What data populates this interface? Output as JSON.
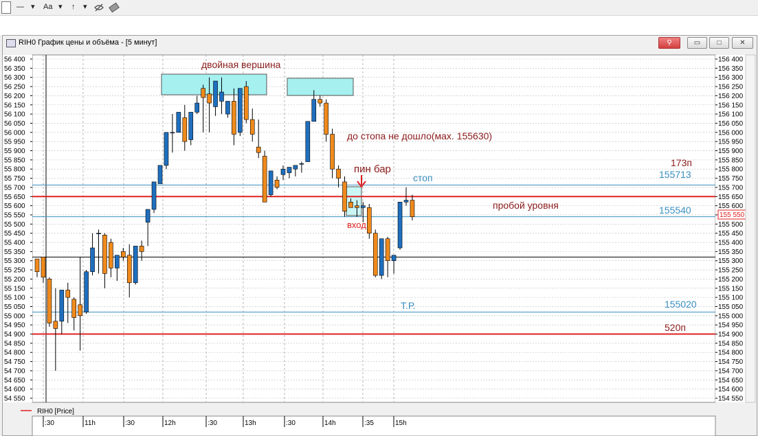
{
  "toolbar": {
    "line_tool": "—",
    "text_tool": "Aa",
    "arrow_tool": "↑",
    "dropdown": "▾"
  },
  "window": {
    "title": "RIH0 График цены и объёма - [5 минут]",
    "legend_label": "RIH0 [Price]"
  },
  "colors": {
    "bull": "#1f6fbf",
    "bear": "#f08a1c",
    "level_red": "#e02020",
    "level_blue": "#3a8fc0",
    "zone_fill": "#a6f0f0",
    "annotation_dark_red": "#8b1a1a",
    "annotation_blue": "#3a8fc0"
  },
  "annotations": {
    "double_top": "двойная вершина",
    "no_stop": "до стопа не дошло(мах. 155630)",
    "pin_bar": "пин бар",
    "entry": "вход",
    "stop": "стоп",
    "breakout": "пробой уровня",
    "tp": "Т.Р.",
    "pts_173": "173п",
    "pts_520": "520п",
    "lvl_155713": "155713",
    "lvl_155540": "155540",
    "lvl_155020": "155020",
    "price_marker": "155 550"
  },
  "chart_data": {
    "type": "candlestick",
    "y_ticks": [
      "56 400",
      "56 350",
      "56 300",
      "56 250",
      "56 200",
      "56 150",
      "56 100",
      "56 050",
      "56 000",
      "55 950",
      "55 900",
      "55 850",
      "55 800",
      "55 750",
      "55 700",
      "55 650",
      "55 600",
      "55 550",
      "55 500",
      "55 450",
      "55 400",
      "55 350",
      "55 300",
      "55 250",
      "55 200",
      "55 150",
      "55 100",
      "55 050",
      "55 000",
      "54 950",
      "54 900",
      "54 850",
      "54 800",
      "54 750",
      "54 700",
      "54 650",
      "54 600",
      "54 550"
    ],
    "y_ticks_right": [
      "156 400",
      "156 350",
      "156 300",
      "156 250",
      "156 200",
      "156 150",
      "156 100",
      "156 050",
      "156 000",
      "155 950",
      "155 900",
      "155 850",
      "155 800",
      "155 750",
      "155 700",
      "155 650",
      "155 600",
      "155 550",
      "155 500",
      "155 450",
      "155 400",
      "155 350",
      "155 300",
      "155 250",
      "155 200",
      "155 150",
      "155 100",
      "155 050",
      "155 000",
      "154 950",
      "154 900",
      "154 850",
      "154 800",
      "154 750",
      "154 700",
      "154 650",
      "154 600",
      "154 550"
    ],
    "ylim": [
      154550,
      156400
    ],
    "x_labels": [
      ":30",
      "11h",
      ":30",
      "12h",
      ":30",
      "13h",
      ":30",
      "14h",
      ":35",
      "15h"
    ],
    "levels": [
      155713,
      155650,
      155540,
      155320,
      155020,
      154900
    ],
    "candles": [
      [
        155310,
        155310,
        155240,
        155210
      ],
      [
        155320,
        155320,
        155210,
        155180
      ],
      [
        155200,
        155210,
        154960,
        154940
      ],
      [
        154970,
        155150,
        154930,
        154700
      ],
      [
        154970,
        155140,
        155140,
        154900
      ],
      [
        155140,
        155180,
        155100,
        154960
      ],
      [
        155090,
        155100,
        154990,
        154920
      ],
      [
        155060,
        155320,
        155000,
        154810
      ],
      [
        155020,
        155250,
        155240,
        155010
      ],
      [
        155240,
        155450,
        155370,
        155220
      ],
      [
        155450,
        155470,
        155450,
        155230
      ],
      [
        155440,
        155450,
        155230,
        155150
      ],
      [
        155400,
        155420,
        155260,
        155210
      ],
      [
        155260,
        155310,
        155330,
        155190
      ],
      [
        155350,
        155370,
        155320,
        155300
      ],
      [
        155330,
        155390,
        155180,
        155100
      ],
      [
        155180,
        155200,
        155380,
        155170
      ],
      [
        155380,
        155410,
        155350,
        155300
      ],
      [
        155510,
        155520,
        155580,
        155380
      ],
      [
        155580,
        155590,
        155730,
        155560
      ],
      [
        155720,
        155720,
        155820,
        155720
      ],
      [
        155820,
        155870,
        156000,
        155800
      ],
      [
        156000,
        156100,
        156000,
        155890
      ],
      [
        156000,
        156050,
        156110,
        156080
      ],
      [
        156080,
        156150,
        155950,
        155900
      ],
      [
        155960,
        156020,
        156110,
        155930
      ],
      [
        156110,
        156200,
        156160,
        156100
      ],
      [
        156240,
        156260,
        156190,
        156000
      ],
      [
        156210,
        156300,
        156160,
        156000
      ],
      [
        156140,
        156260,
        156280,
        156090
      ],
      [
        156170,
        156300,
        156220,
        156100
      ],
      [
        156100,
        156160,
        156170,
        156080
      ],
      [
        156170,
        156240,
        155990,
        155930
      ],
      [
        156000,
        156230,
        156240,
        155980
      ],
      [
        156250,
        156280,
        156070,
        156050
      ],
      [
        156070,
        156130,
        155990,
        155950
      ],
      [
        155920,
        156070,
        155890,
        155860
      ],
      [
        155870,
        155900,
        155620,
        155860
      ],
      [
        155660,
        155680,
        155790,
        155650
      ],
      [
        155740,
        155760,
        155700,
        155690
      ],
      [
        155770,
        155820,
        155800,
        155740
      ],
      [
        155780,
        155800,
        155810,
        155750
      ],
      [
        155800,
        155820,
        155820,
        155760
      ],
      [
        155830,
        155840,
        155830,
        155780
      ],
      [
        155840,
        156050,
        156060,
        155850
      ],
      [
        156060,
        156230,
        156180,
        156060
      ],
      [
        156180,
        156200,
        156160,
        156140
      ],
      [
        156160,
        156180,
        155990,
        155950
      ],
      [
        155990,
        156020,
        155800,
        155750
      ],
      [
        155800,
        155820,
        155750,
        155700
      ],
      [
        155730,
        155760,
        155570,
        155540
      ],
      [
        155620,
        155640,
        155590,
        155600
      ],
      [
        155600,
        155630,
        155590,
        155540
      ],
      [
        155590,
        155620,
        155600,
        155510
      ],
      [
        155590,
        155610,
        155450,
        155420
      ],
      [
        155450,
        155470,
        155220,
        155210
      ],
      [
        155220,
        155240,
        155420,
        155200
      ],
      [
        155420,
        155430,
        155300,
        155210
      ],
      [
        155300,
        155330,
        155330,
        155230
      ],
      [
        155370,
        155620,
        155620,
        155360
      ],
      [
        155620,
        155700,
        155630,
        155600
      ],
      [
        155630,
        155660,
        155540,
        155520
      ]
    ]
  }
}
